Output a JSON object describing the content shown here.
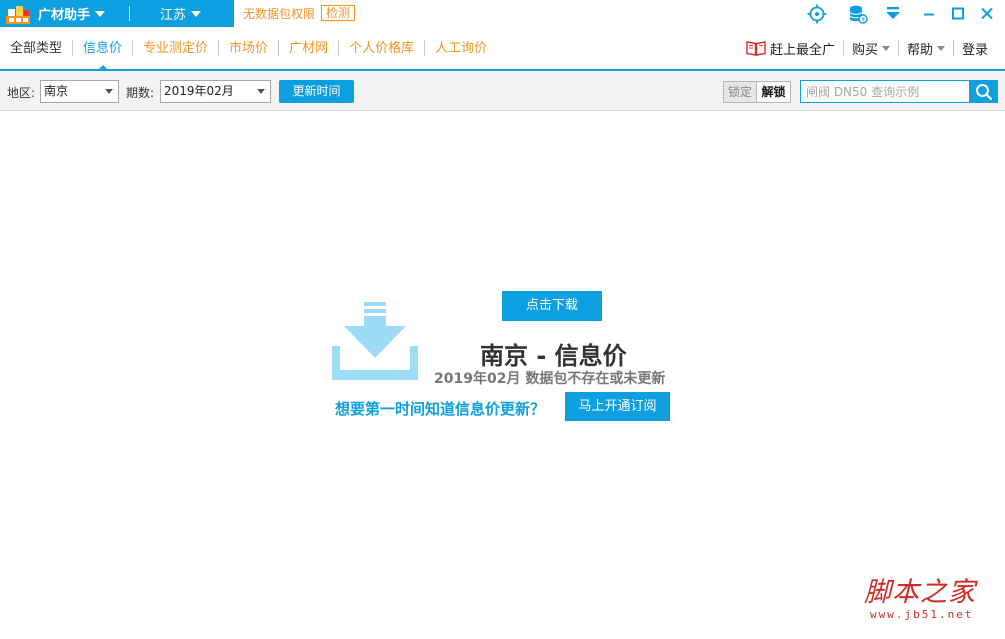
{
  "titlebar": {
    "app_name": "广材助手",
    "region": "江苏",
    "no_data_text": "无数据包权限",
    "check_label": "检测",
    "icons": [
      "locate-icon",
      "database-icon",
      "download-icon",
      "minimize-icon",
      "maximize-icon",
      "close-icon"
    ]
  },
  "nav": {
    "tabs": [
      {
        "label": "全部类型"
      },
      {
        "label": "信息价"
      },
      {
        "label": "专业测定价"
      },
      {
        "label": "市场价"
      },
      {
        "label": "广材网"
      },
      {
        "label": "个人价格库"
      },
      {
        "label": "人工询价"
      }
    ],
    "active_tab": "信息价",
    "right": {
      "promo_label": "赶上最全广",
      "buy_label": "购买",
      "help_label": "帮助",
      "login_label": "登录"
    }
  },
  "filter": {
    "region_label": "地区:",
    "region_value": "南京",
    "period_label": "期数:",
    "period_value": "2019年02月",
    "update_button": "更新时间",
    "lock_button": "锁定",
    "unlock_button": "解锁",
    "search_placeholder": "闸阀 DN50 查询示例"
  },
  "main": {
    "download_button": "点击下载",
    "title": "南京 - 信息价",
    "subtitle": "2019年02月 数据包不存在或未更新",
    "prompt": "想要第一时间知道信息价更新？",
    "subscribe_button": "马上开通订阅"
  },
  "watermark": {
    "cn": "脚本之家",
    "en": "www.jb51.net"
  },
  "colors": {
    "accent": "#0e9fe0",
    "orange": "#f39422",
    "icon_light_blue": "#9ddcf7",
    "watermark_red": "#cf2b26"
  }
}
